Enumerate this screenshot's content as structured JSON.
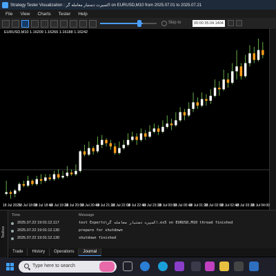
{
  "window": {
    "title": "Strategy Tester Visualization : اکسپرت دستیار معامله گر on EURUSD,M10 from 2025.07.01 to 2025.07.21"
  },
  "menu": {
    "items": [
      "File",
      "View",
      "Charts",
      "Tester",
      "Help"
    ]
  },
  "toolbar": {
    "skip_label": "Skip to",
    "skip_value": "00:00 35.04.1404",
    "speed_fraction": 0.82
  },
  "chart": {
    "info": "EURUSD,M10  1.16209  1.16266  1.16188  1.16242",
    "x_labels": [
      "18 Jul 2025",
      "18 Jul 18:00",
      "18 Jul 18:40",
      "18 Jul 19:20",
      "18 Jul 20:00",
      "18 Jul 20:40",
      "18 Jul 21:20",
      "18 Jul 22:00",
      "18 Jul 22:40",
      "18 Jul 23:20",
      "18 Jul 00:00",
      "18 Jul 00:40",
      "18 Jul 01:20",
      "18 Jul 02:00",
      "18 Jul 02:40",
      "18 Jul 03:20",
      "18 Jul 04:00"
    ],
    "colors": {
      "bull": "#ffffff",
      "bear": "#ff9c1a",
      "wick": "#7fd85a",
      "background": "#000000"
    }
  },
  "chart_data": {
    "type": "candlestick",
    "symbol": "EURUSD",
    "timeframe": "M10",
    "last_bar": {
      "open": 1.16209,
      "high": 1.16266,
      "low": 1.16188,
      "close": 1.16242
    },
    "candles": [
      [
        10,
        11,
        18,
        9
      ],
      [
        11,
        10,
        12,
        7
      ],
      [
        10,
        12,
        13,
        8
      ],
      [
        12,
        16,
        17,
        11
      ],
      [
        16,
        15,
        18,
        14
      ],
      [
        15,
        18,
        21,
        14
      ],
      [
        18,
        16,
        19,
        15
      ],
      [
        16,
        19,
        21,
        15
      ],
      [
        19,
        18,
        22,
        16
      ],
      [
        18,
        20,
        22,
        17
      ],
      [
        20,
        19,
        22,
        18
      ],
      [
        19,
        22,
        24,
        18
      ],
      [
        22,
        20,
        25,
        19
      ],
      [
        20,
        21,
        24,
        19
      ],
      [
        21,
        23,
        27,
        20
      ],
      [
        23,
        22,
        25,
        21
      ],
      [
        22,
        24,
        28,
        21
      ],
      [
        24,
        36,
        37,
        23
      ],
      [
        36,
        34,
        40,
        33
      ],
      [
        34,
        38,
        42,
        33
      ],
      [
        38,
        36,
        39,
        34
      ],
      [
        36,
        40,
        45,
        35
      ],
      [
        40,
        43,
        46,
        38
      ],
      [
        43,
        41,
        44,
        39
      ],
      [
        41,
        39,
        43,
        37
      ],
      [
        39,
        35,
        41,
        34
      ],
      [
        35,
        38,
        42,
        34
      ],
      [
        38,
        40,
        43,
        37
      ],
      [
        40,
        43,
        47,
        39
      ],
      [
        43,
        45,
        48,
        42
      ],
      [
        45,
        43,
        47,
        40
      ],
      [
        43,
        47,
        50,
        42
      ],
      [
        47,
        45,
        49,
        43
      ],
      [
        45,
        48,
        52,
        44
      ],
      [
        48,
        50,
        53,
        47
      ],
      [
        50,
        48,
        52,
        46
      ],
      [
        48,
        51,
        55,
        47
      ],
      [
        51,
        53,
        58,
        50
      ],
      [
        53,
        52,
        56,
        49
      ],
      [
        52,
        55,
        60,
        51
      ],
      [
        55,
        60,
        63,
        54
      ],
      [
        60,
        58,
        62,
        55
      ],
      [
        58,
        62,
        66,
        57
      ],
      [
        62,
        66,
        72,
        60
      ],
      [
        66,
        64,
        69,
        62
      ],
      [
        64,
        68,
        72,
        63
      ],
      [
        68,
        67,
        71,
        64
      ],
      [
        67,
        70,
        74,
        65
      ],
      [
        70,
        75,
        80,
        69
      ],
      [
        75,
        74,
        79,
        70
      ],
      [
        74,
        80,
        86,
        73
      ],
      [
        80,
        78,
        84,
        75
      ],
      [
        78,
        85,
        90,
        77
      ],
      [
        85,
        88,
        98,
        80
      ],
      [
        88,
        82,
        90,
        80
      ],
      [
        82,
        90,
        95,
        81
      ],
      [
        90,
        96,
        101,
        88
      ],
      [
        96,
        92,
        100,
        90
      ],
      [
        92,
        98,
        105,
        91
      ],
      [
        98,
        95,
        103,
        93
      ]
    ]
  },
  "journal": {
    "headers": {
      "time": "Time",
      "message": "Message"
    },
    "rows": [
      {
        "time": "2025.07.22 19:01:12.117",
        "message": "test Experts\\اکسپرت دستیار معامله گر.ex5 on EURUSD,M10 thread finished"
      },
      {
        "time": "2025.07.22 19:01:12.130",
        "message": "prepare for shutdown"
      },
      {
        "time": "2025.07.22 19:01:12.130",
        "message": "shutdown finished"
      }
    ],
    "side_label": "Toolbox"
  },
  "tabs": [
    {
      "label": "Trade",
      "active": false
    },
    {
      "label": "History",
      "active": false
    },
    {
      "label": "Operations",
      "active": false
    },
    {
      "label": "Journal",
      "active": true
    }
  ],
  "taskbar": {
    "search_placeholder": "Type here to search",
    "icons": [
      "task-view-icon",
      "edge-icon",
      "visual-studio-icon",
      "store-icon",
      "app-icon",
      "file-explorer-icon",
      "terminal-icon",
      "metatrader-icon"
    ]
  }
}
